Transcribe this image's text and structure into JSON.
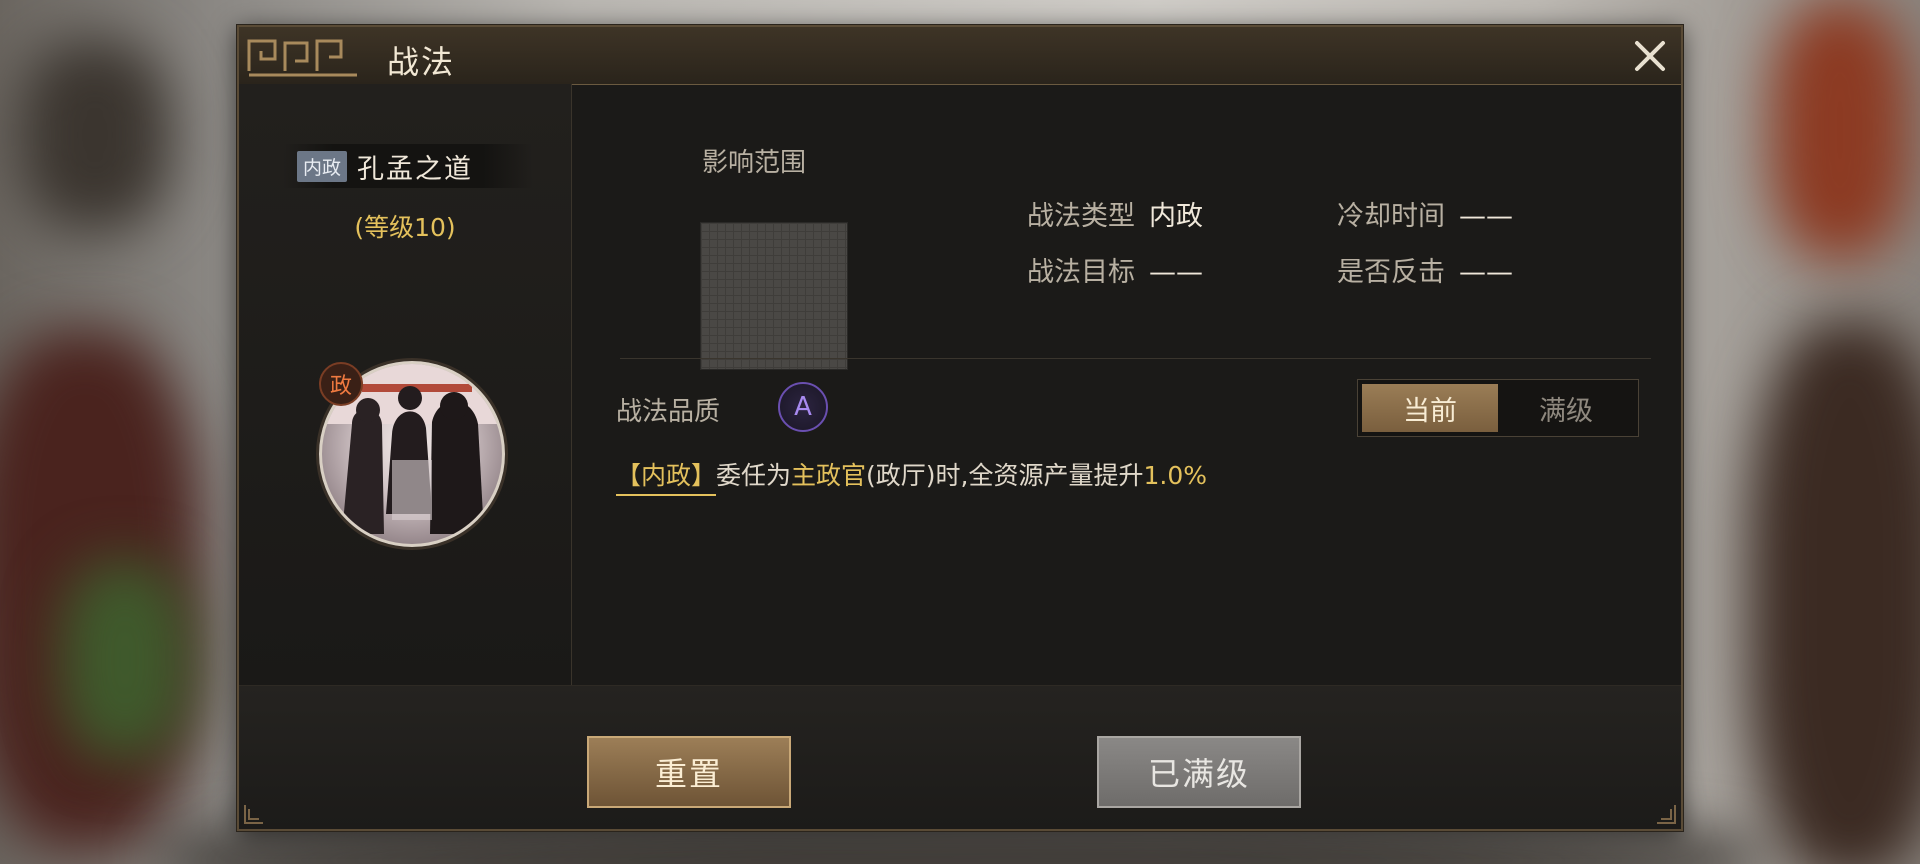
{
  "dialog": {
    "title": "战法",
    "close_icon": "close-icon"
  },
  "skill": {
    "type_badge": "内政",
    "name": "孔孟之道",
    "level": "(等级10)",
    "portrait_badge": "政"
  },
  "details": {
    "area_label": "影响范围",
    "type_label": "战法类型",
    "type_value": "内政",
    "target_label": "战法目标",
    "target_value": "——",
    "cooldown_label": "冷却时间",
    "cooldown_value": "——",
    "counter_label": "是否反击",
    "counter_value": "——",
    "quality_label": "战法品质",
    "quality_grade": "A"
  },
  "toggle": {
    "current": "当前",
    "max": "满级"
  },
  "description": {
    "tag": "【内政】",
    "part1": "委任为",
    "highlight1": "主政官",
    "part2": "(政厅)时,全资源产量提升",
    "highlight2": "1.0%"
  },
  "buttons": {
    "reset": "重置",
    "maxed": "已满级"
  },
  "colors": {
    "gold": "#e4c15c",
    "grade_purple": "#a88af0",
    "accent_bronze": "#9a7d56"
  }
}
